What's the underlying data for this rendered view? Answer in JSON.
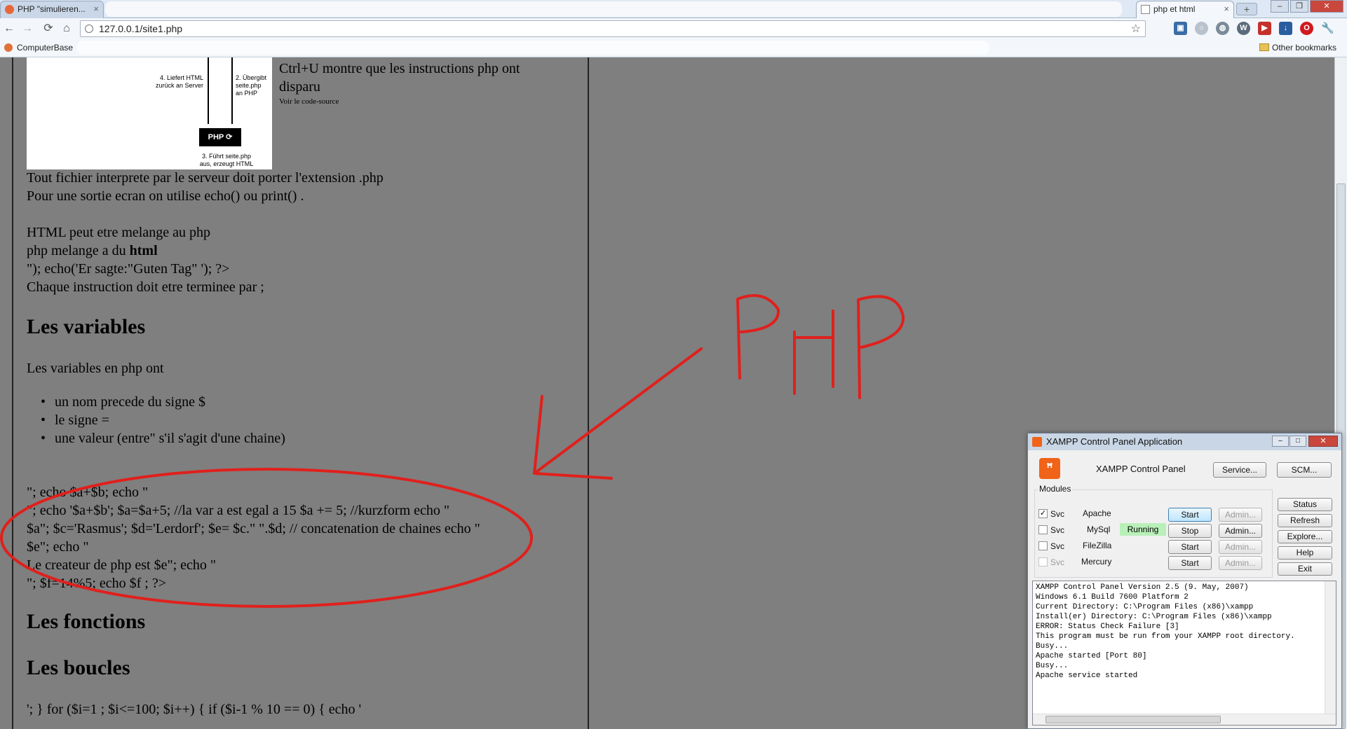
{
  "browser": {
    "tabs": [
      {
        "label": "PHP \"simulieren...",
        "active": false
      },
      {
        "label": "php et html",
        "active": true
      }
    ],
    "new_tab_label": "+",
    "url": "127.0.0.1/site1.php",
    "bookmarks": {
      "left": "ComputerBase",
      "right": "Other bookmarks"
    },
    "icons": [
      "back-icon",
      "forward-icon",
      "reload-icon",
      "home-icon",
      "star-icon",
      "wrench-icon"
    ]
  },
  "page": {
    "diagram": {
      "left_label": "4. Liefert HTML\nzurück an Server",
      "right_label": "2. Übergibt\nseite.php\nan PHP",
      "bottom_label": "3. Führt seite.php\naus, erzeugt HTML",
      "box_label": "PHP ⟳"
    },
    "intro": {
      "line1": "Ctrl+U montre que les instructions php ont",
      "line2": "disparu",
      "small": "Voir le code-source"
    },
    "paragraphs": [
      "Tout fichier interprete par le serveur doit porter l'extension .php",
      "Pour une sortie ecran on utilise echo() ou print() .",
      "HTML peut etre melange au php",
      "php melange a du ",
      "\"); echo('Er sagte:\"Guten Tag\" '); ?>",
      "Chaque instruction doit etre terminee par ;"
    ],
    "bold_word": "html",
    "heading_variables": "Les variables",
    "variables_intro": "Les variables en php ont",
    "bullets": [
      "un nom precede du signe $",
      "le signe =",
      "une valeur (entre\" s'il s'agit d'une chaine)"
    ],
    "code_lines": [
      "\"; echo $a+$b; echo \"",
      "\"; echo '$a+$b'; $a=$a+5; //la var a est egal a 15 $a += 5; //kurzform echo \"",
      "$a\"; $c='Rasmus'; $d='Lerdorf'; $e= $c.\" \".$d; // concatenation de chaines echo \"",
      "$e\"; echo \"",
      "Le createur de php est $e\"; echo \"",
      "\"; $f=14%5; echo $f ; ?>"
    ],
    "heading_fonctions": "Les fonctions",
    "heading_boucles": "Les boucles",
    "loop_line": "'; } for ($i=1 ; $i<=100; $i++) { if ($i-1 % 10 == 0) { echo '",
    "annotation": "PHP",
    "annotation_color": "#e0201c"
  },
  "xampp": {
    "title": "XAMPP Control Panel Application",
    "header": "XAMPP Control Panel",
    "buttons_top": [
      "Service...",
      "SCM..."
    ],
    "modules_label": "Modules",
    "svc_label": "Svc",
    "modules": [
      {
        "name": "Apache",
        "checked": true,
        "status": "",
        "action": "Start",
        "admin": "Admin...",
        "admin_enabled": false
      },
      {
        "name": "MySql",
        "checked": false,
        "status": "Running",
        "action": "Stop",
        "admin": "Admin...",
        "admin_enabled": true
      },
      {
        "name": "FileZilla",
        "checked": false,
        "status": "",
        "action": "Start",
        "admin": "Admin...",
        "admin_enabled": false
      },
      {
        "name": "Mercury",
        "checked": false,
        "status": "",
        "action": "Start",
        "admin": "Admin...",
        "admin_enabled": false
      }
    ],
    "side_buttons": [
      "Status",
      "Refresh",
      "Explore...",
      "Help",
      "Exit"
    ],
    "log": [
      "XAMPP Control Panel Version 2.5 (9. May, 2007)",
      "Windows 6.1 Build 7600 Platform 2",
      "Current Directory: C:\\Program Files (x86)\\xampp",
      "Install(er) Directory: C:\\Program Files (x86)\\xampp",
      "ERROR: Status Check Failure [3]",
      "This program must be run from your XAMPP root directory.",
      "Busy...",
      "Apache started [Port 80]",
      "Busy...",
      "Apache service started"
    ]
  }
}
